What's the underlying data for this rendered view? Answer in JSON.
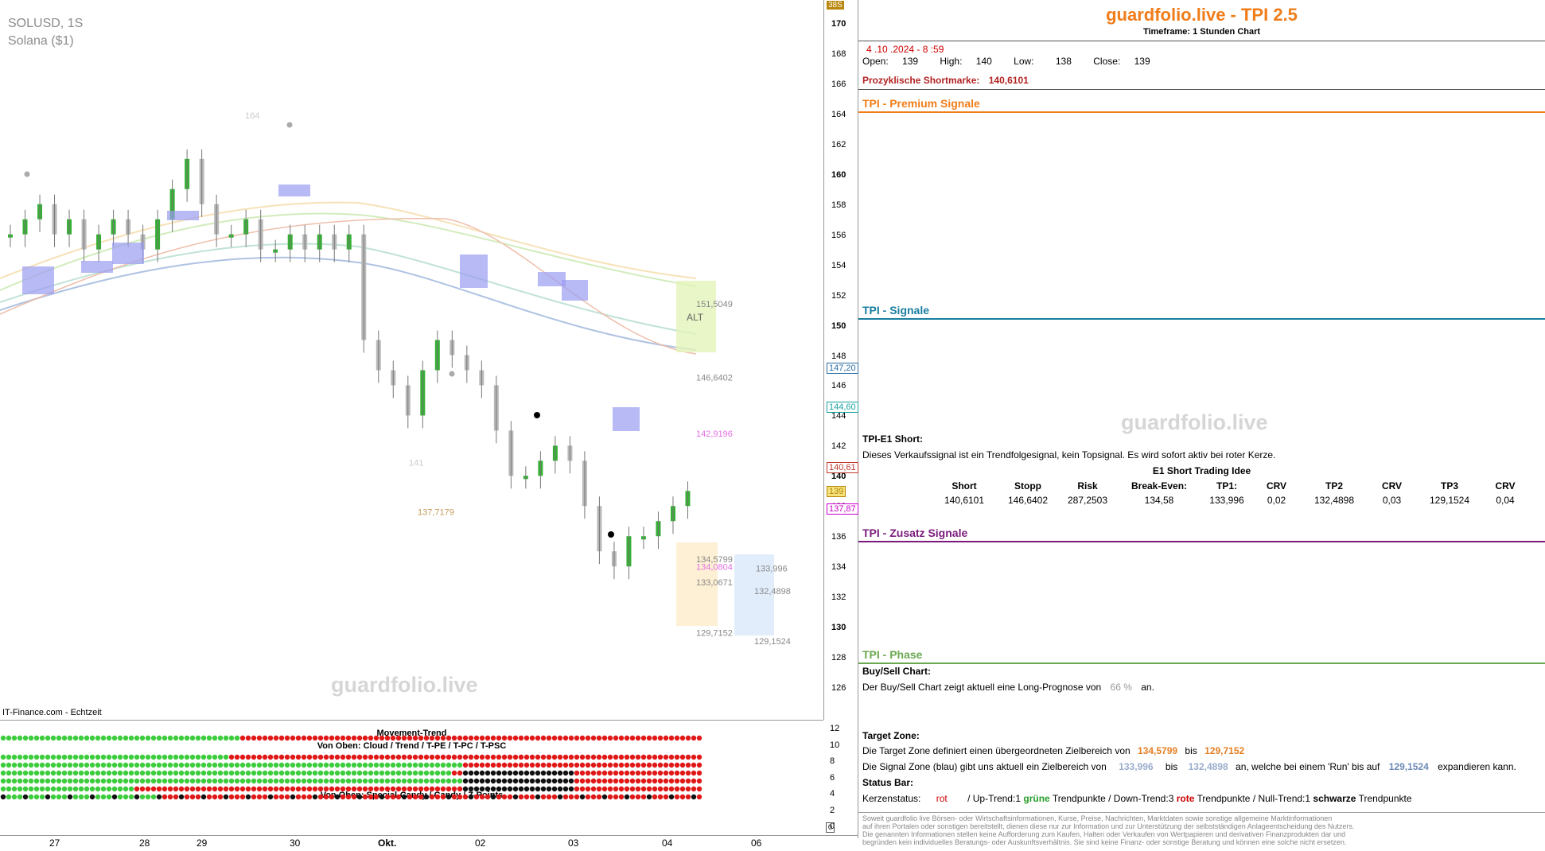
{
  "symbol": "SOLUSD, 1S",
  "instrument": "Solana ($1)",
  "watermark": "guardfolio.live",
  "source": "IT-Finance.com - Echtzeit",
  "countdown": "38S",
  "chart_data": {
    "type": "candlestick",
    "y_axis": {
      "min": 125,
      "max": 171,
      "ticks": [
        170,
        168,
        166,
        164,
        162,
        160,
        158,
        156,
        154,
        152,
        150,
        148,
        146,
        144,
        142,
        140,
        138,
        136,
        134,
        132,
        130,
        128,
        126
      ]
    },
    "x_tick_labels": [
      "27",
      "28",
      "29",
      "30",
      "Okt.",
      "02",
      "03",
      "04",
      "06"
    ],
    "price_tags": [
      {
        "label": "147,20",
        "value": 147.2,
        "color": "#2b6ea6"
      },
      {
        "label": "144,60",
        "value": 144.6,
        "color": "#1aa3a3"
      },
      {
        "label": "140,61",
        "value": 140.61,
        "color": "#c0392b"
      },
      {
        "label": "139",
        "value": 139,
        "color": "#b8860b"
      },
      {
        "label": "137,87",
        "value": 137.87,
        "color": "#cc00cc"
      }
    ],
    "levels": [
      {
        "label": "151,5049",
        "value": 151.5049
      },
      {
        "label": "146,6402",
        "value": 146.6402
      },
      {
        "label": "142,9196",
        "value": 142.9196
      },
      {
        "label": "134,5799",
        "value": 134.5799
      },
      {
        "label": "134,0804",
        "value": 134.0804
      },
      {
        "label": "133,0671",
        "value": 133.0671
      },
      {
        "label": "129,7152",
        "value": 129.7152
      },
      {
        "label": "133,996",
        "value": 133.996
      },
      {
        "label": "132,4898",
        "value": 132.4898
      },
      {
        "label": "129,1524",
        "value": 129.1524
      },
      {
        "label": "137,7179",
        "value": 137.7179
      },
      {
        "label": "164",
        "value": 164
      },
      {
        "label": "141",
        "value": 141
      }
    ],
    "alt_label": "ALT",
    "candles_approx": [
      156,
      157,
      158,
      156,
      157,
      155,
      156,
      157,
      156,
      155,
      157,
      159,
      161,
      158,
      156,
      156,
      157,
      155,
      155,
      156,
      155,
      156,
      155,
      156,
      149,
      147,
      146,
      144,
      147,
      149,
      148,
      147,
      146,
      143,
      140,
      140,
      141,
      142,
      141,
      138,
      135,
      134,
      136,
      136,
      137,
      138,
      139
    ]
  },
  "indicators": {
    "y_ticks": [
      "12",
      "10",
      "8",
      "6",
      "4",
      "2",
      "0"
    ],
    "movement_trend": "Movement-Trend",
    "von_oben_1": "Von Oben: Cloud / Trend / T-PE / T-PC / T-PSC",
    "von_oben_2": "Von Oben: Special-Candy / Candy / Z-Points"
  },
  "panel": {
    "title": "guardfolio.live - TPI 2.5",
    "timeframe": "Timeframe: 1 Stunden Chart",
    "datetime": "4 .10 .2024  - 8 :59",
    "open_label": "Open:",
    "open": "139",
    "high_label": "High:",
    "high": "140",
    "low_label": "Low:",
    "low": "138",
    "close_label": "Close:",
    "close": "139",
    "short_label": "Prozyklische Shortmarke:",
    "short_value": "140,6101",
    "premium": "TPI - Premium Signale",
    "signale": "TPI - Signale",
    "e1_head": "TPI-E1 Short:",
    "e1_text": "Dieses Verkaufssignal ist ein Trendfolgesignal, kein Topsignal. Es wird sofort aktiv bei roter Kerze.",
    "e1_idea": "E1 Short Trading Idee",
    "table_headers": [
      "Short",
      "Stopp",
      "Risk",
      "Break-Even:",
      "TP1:",
      "CRV",
      "TP2",
      "CRV",
      "TP3",
      "CRV"
    ],
    "table_values": [
      "140,6101",
      "146,6402",
      "287,2503",
      "134,58",
      "133,996",
      "0,02",
      "132,4898",
      "0,03",
      "129,1524",
      "0,04"
    ],
    "zusatz": "TPI - Zusatz Signale",
    "phase": "TPI - Phase",
    "bs_head": "Buy/Sell Chart:",
    "bs_text_a": "Der Buy/Sell Chart zeigt aktuell eine Long-Prognose von",
    "bs_pct": "66 %",
    "bs_text_b": "an.",
    "tz_head": "Target Zone:",
    "tz_a": "Die Target Zone definiert einen übergeordneten Zielbereich von",
    "tz_v1": "134,5799",
    "tz_b": "bis",
    "tz_v2": "129,7152",
    "sz_a": "Die Signal Zone (blau) gibt uns aktuell ein Zielbereich von",
    "sz_v1": "133,996",
    "sz_b": "bis",
    "sz_v2": "132,4898",
    "sz_c": "an, welche bei einem 'Run' bis auf",
    "sz_v3": "129,1524",
    "sz_d": "expandieren kann.",
    "status_head": "Status Bar:",
    "ks_label": "Kerzenstatus:",
    "ks_value": "rot",
    "up_label": "/ Up-Trend:",
    "up_n": "1",
    "up_word": "grüne",
    "tp_word": "Trendpunkte",
    "down_label": "/ Down-Trend:",
    "down_n": "3",
    "down_word": "rote",
    "null_label": "/ Null-Trend:",
    "null_n": "1",
    "null_word": "schwarze",
    "disclaimer_1": "Soweit guardfolio live Börsen- oder Wirtschaftsinformationen, Kurse, Preise, Nachrichten, Marktdaten sowie sonstige allgemeine Marktinformationen",
    "disclaimer_2": "auf ihren Portalen oder sonstigen bereitstellt, dienen diese nur zur Information und zur Unterstützung der selbstständigen Anlageentscheidung des Nutzers.",
    "disclaimer_3": "Die genannten Informationen stellen keine Aufforderung zum Kaufen, Halten oder Verkaufen von Wertpapieren und derivativen Finanzprodukten dar und",
    "disclaimer_4": "begründen kein individuelles Beratungs- oder Auskunftsverhältnis. Sie sind keine Finanz- oder sonstige Beratung und können eine solche nicht ersetzen."
  }
}
